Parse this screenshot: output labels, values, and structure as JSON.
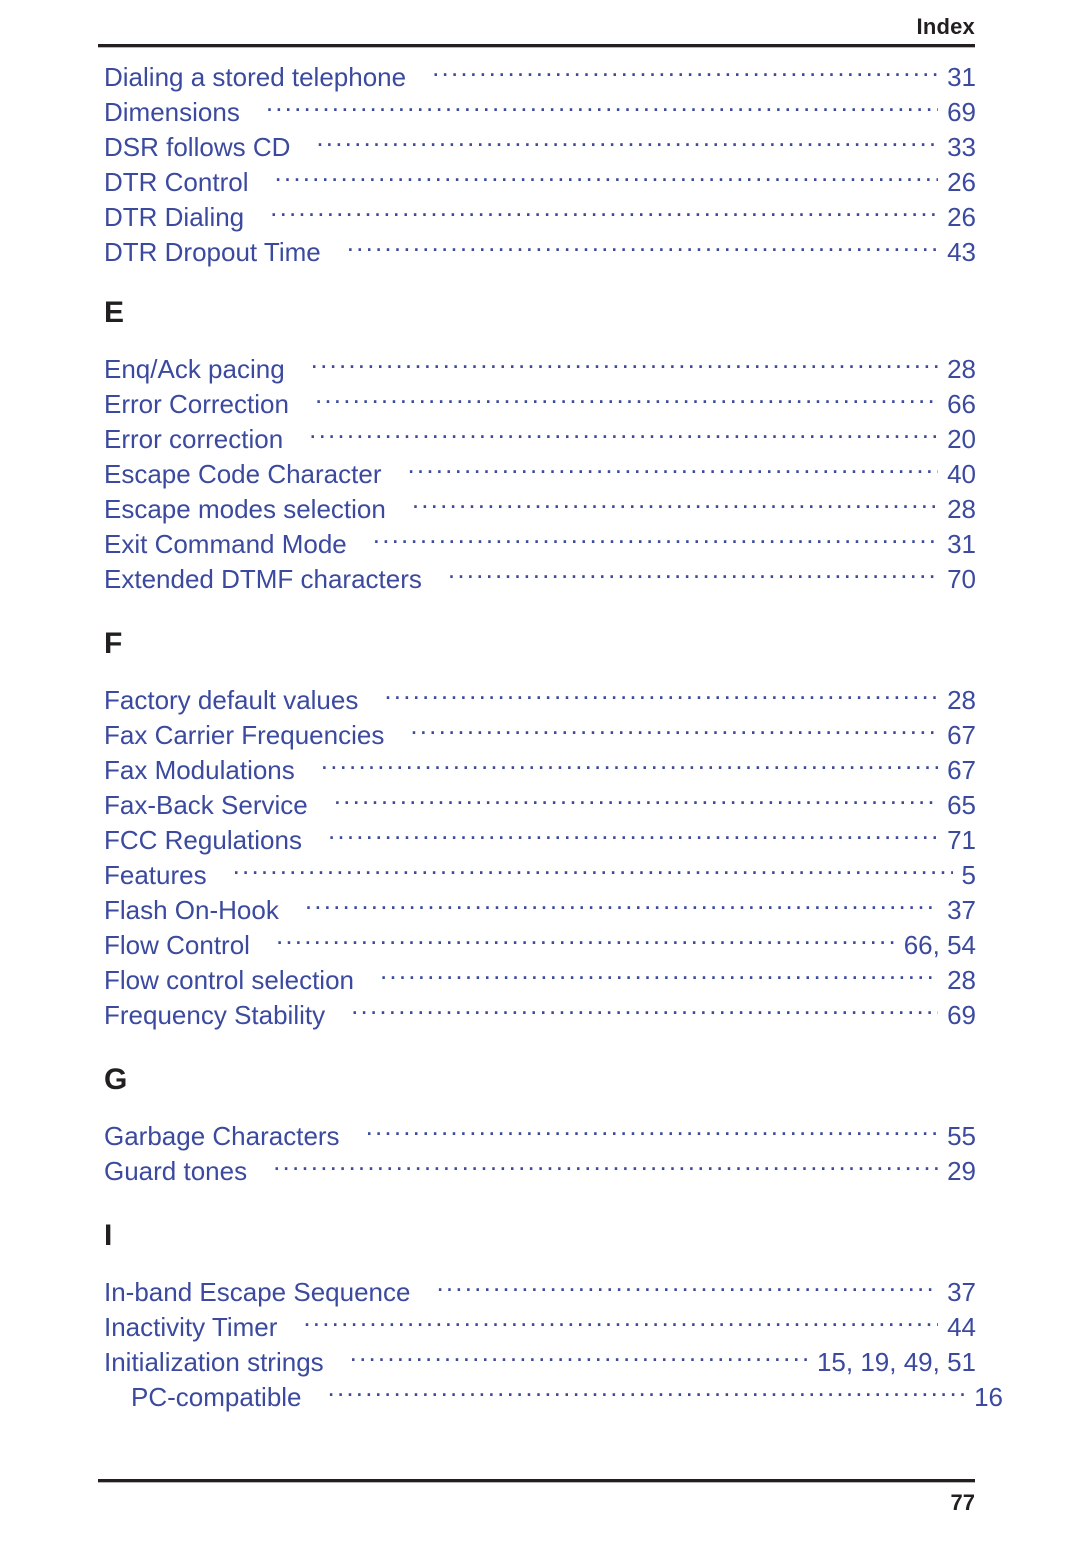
{
  "header": {
    "title": "Index"
  },
  "colors": {
    "entry_text": "#3b4a9e",
    "heading_text": "#231f20",
    "rule": "#231f20",
    "background": "#ffffff"
  },
  "index": {
    "continued_entries": [
      {
        "label": "Dialing a stored telephone",
        "page": "31"
      },
      {
        "label": "Dimensions",
        "page": "69"
      },
      {
        "label": "DSR follows CD",
        "page": "33"
      },
      {
        "label": "DTR Control",
        "page": "26"
      },
      {
        "label": "DTR Dialing",
        "page": "26"
      },
      {
        "label": "DTR Dropout Time",
        "page": "43"
      }
    ],
    "sections": [
      {
        "letter": "E",
        "entries": [
          {
            "label": "Enq/Ack pacing",
            "page": "28"
          },
          {
            "label": "Error Correction",
            "page": "66"
          },
          {
            "label": "Error correction",
            "page": "20"
          },
          {
            "label": "Escape Code Character",
            "page": "40"
          },
          {
            "label": "Escape modes selection",
            "page": "28"
          },
          {
            "label": "Exit Command Mode",
            "page": "31"
          },
          {
            "label": "Extended DTMF characters",
            "page": "70"
          }
        ]
      },
      {
        "letter": "F",
        "entries": [
          {
            "label": "Factory default values",
            "page": "28"
          },
          {
            "label": "Fax Carrier Frequencies",
            "page": "67"
          },
          {
            "label": "Fax Modulations",
            "page": "67"
          },
          {
            "label": "Fax-Back Service",
            "page": "65"
          },
          {
            "label": "FCC Regulations",
            "page": "71"
          },
          {
            "label": "Features",
            "page": "5"
          },
          {
            "label": "Flash On-Hook",
            "page": "37"
          },
          {
            "label": "Flow Control",
            "page": "66, 54"
          },
          {
            "label": "Flow control selection",
            "page": "28"
          },
          {
            "label": "Frequency Stability",
            "page": "69"
          }
        ]
      },
      {
        "letter": "G",
        "entries": [
          {
            "label": "Garbage Characters",
            "page": "55"
          },
          {
            "label": "Guard tones",
            "page": "29"
          }
        ]
      },
      {
        "letter": "I",
        "entries": [
          {
            "label": "In-band Escape Sequence",
            "page": "37"
          },
          {
            "label": "Inactivity Timer",
            "page": "44"
          },
          {
            "label": "Initialization strings",
            "page": "15,  19,  49,  51"
          },
          {
            "label": "PC-compatible",
            "page": "16",
            "sub": true
          }
        ]
      }
    ]
  },
  "footer": {
    "page_number": "77"
  }
}
